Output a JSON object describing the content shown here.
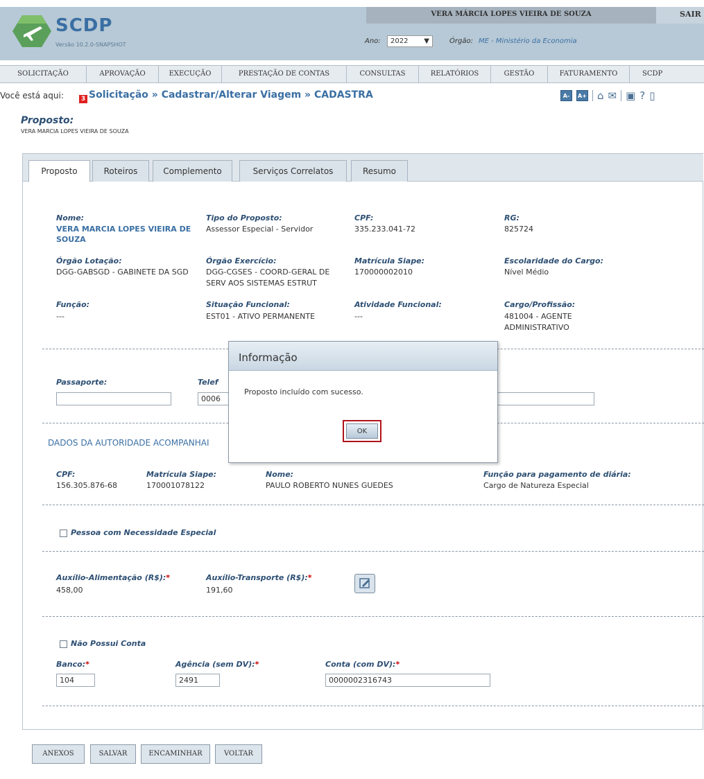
{
  "header": {
    "app_title": "SCDP",
    "version": "Versão 10.2.0-SNAPSHOT",
    "user": "VERA MÁRCIA LOPES VIEIRA DE SOUZA",
    "logout": "SAIR",
    "ano_label": "Ano:",
    "ano_value": "2022",
    "orgao_label": "Órgão:",
    "orgao_value": "ME - Ministério da Economia"
  },
  "menu": [
    "SOLICITAÇÃO",
    "APROVAÇÃO",
    "EXECUÇÃO",
    "PRESTAÇÃO DE CONTAS",
    "CONSULTAS",
    "RELATÓRIOS",
    "GESTÃO",
    "FATURAMENTO",
    "SCDP"
  ],
  "breadcrumb": {
    "label": "Você está aqui:",
    "path": "Solicitação » Cadastrar/Alterar Viagem » CADASTRA",
    "font_minus": "A-",
    "font_plus": "A+",
    "notifications": "3"
  },
  "proposto": {
    "heading": "Proposto:",
    "name": "VERA MARCIA LOPES VIEIRA DE SOUZA"
  },
  "tabs": [
    "Proposto",
    "Roteiros",
    "Complemento",
    "Serviços Correlatos",
    "Resumo"
  ],
  "fields": {
    "nome_label": "Nome:",
    "nome_value": "VERA MARCIA LOPES VIEIRA DE SOUZA",
    "tipo_label": "Tipo do Proposto:",
    "tipo_value": "Assessor Especial - Servidor",
    "cpf_label": "CPF:",
    "cpf_value": "335.233.041-72",
    "rg_label": "RG:",
    "rg_value": "825724",
    "lotacao_label": "Órgão Lotação:",
    "lotacao_value": "DGG-GABSGD - GABINETE DA SGD",
    "exercicio_label": "Órgão Exercício:",
    "exercicio_value": "DGG-CGSES - COORD-GERAL DE SERV AOS SISTEMAS ESTRUT",
    "matricula_label": "Matrícula Siape:",
    "matricula_value": "170000002010",
    "escolaridade_label": "Escolaridade do Cargo:",
    "escolaridade_value": "Nível Médio",
    "funcao_label": "Função:",
    "funcao_value": "---",
    "situacao_label": "Situação Funcional:",
    "situacao_value": "EST01 - ATIVO PERMANENTE",
    "atividade_label": "Atividade Funcional:",
    "atividade_value": "---",
    "cargo_label": "Cargo/Profissão:",
    "cargo_value": "481004 - AGENTE ADMINISTRATIVO",
    "passaporte_label": "Passaporte:",
    "passaporte_value": "",
    "telefone_label": "Telef",
    "telefone_value": "0006"
  },
  "autoridade": {
    "title": "DADOS DA AUTORIDADE ACOMPANHAI",
    "cpf_label": "CPF:",
    "cpf_value": "156.305.876-68",
    "matricula_label": "Matrícula Siape:",
    "matricula_value": "170001078122",
    "nome_label": "Nome:",
    "nome_value": "PAULO ROBERTO NUNES GUEDES",
    "funcao_label": "Função para pagamento de diária:",
    "funcao_value": "Cargo de Natureza Especial"
  },
  "necessidade_label": "Pessoa com Necessidade Especial",
  "auxilios": {
    "alimentacao_label": "Auxílio-Alimentação (R$):",
    "alimentacao_value": "458,00",
    "transporte_label": "Auxílio-Transporte (R$):",
    "transporte_value": "191,60",
    "required_mark": "*"
  },
  "conta": {
    "nao_possui_label": "Não Possui Conta",
    "banco_label": "Banco:",
    "banco_value": "104",
    "agencia_label": "Agência (sem DV):",
    "agencia_value": "2491",
    "conta_label": "Conta (com DV):",
    "conta_value": "0000002316743"
  },
  "buttons": [
    "ANEXOS",
    "SALVAR",
    "ENCAMINHAR",
    "VOLTAR"
  ],
  "modal": {
    "title": "Informação",
    "message": "Proposto incluído com sucesso.",
    "ok": "OK"
  }
}
